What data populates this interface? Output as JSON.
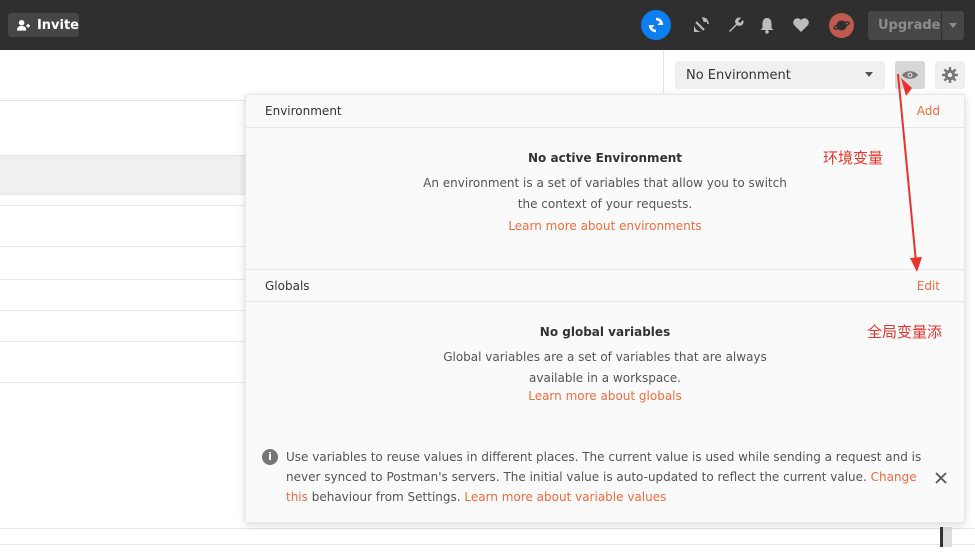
{
  "topbar": {
    "invite_label": "Invite",
    "upgrade_label": "Upgrade",
    "icons": [
      "user-plus-icon",
      "sync-icon",
      "satellite-icon",
      "wrench-icon",
      "bell-icon",
      "heart-icon",
      "avatar-icon",
      "chevron-down-icon"
    ]
  },
  "env_bar": {
    "selected_environment": "No Environment"
  },
  "popover": {
    "environment": {
      "title": "Environment",
      "action": "Add",
      "heading": "No active Environment",
      "description": "An environment is a set of variables that allow you to switch the context of your requests.",
      "link": "Learn more about environments"
    },
    "globals": {
      "title": "Globals",
      "action": "Edit",
      "heading": "No global variables",
      "description": "Global variables are a set of variables that are always available in a workspace.",
      "link": "Learn more about globals"
    },
    "note": {
      "text_1": "Use variables to reuse values in different places. The current value is used while sending a request and is never synced to Postman's servers. The initial value is auto-updated to reflect the current value. ",
      "link_change": "Change this",
      "text_2": " behaviour from Settings. ",
      "link_learn": "Learn more about variable values"
    }
  },
  "annotations": {
    "env_label": "环境变量",
    "globals_label": "全局变量添"
  },
  "colors": {
    "topbar": "#2f2f2f",
    "accent_orange": "#f26b3a",
    "sync_blue": "#0b7ff2",
    "annotation_red": "#e8322c"
  }
}
